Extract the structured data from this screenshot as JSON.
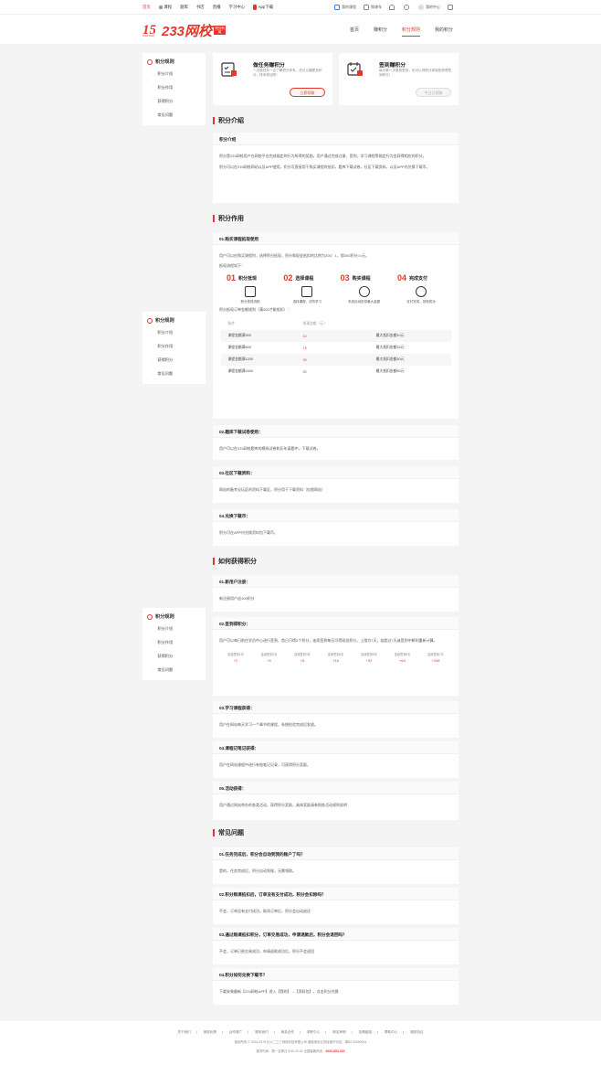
{
  "topbar": {
    "nav": [
      "首页",
      "题库",
      "书店",
      "直播",
      "学习中心"
    ],
    "nav_course": "课程",
    "app": "App下载",
    "right": [
      "我的课程",
      "购课车",
      "",
      "",
      "我的中心",
      ""
    ]
  },
  "logo": {
    "n15": "15",
    "text": "233网校",
    "badge": "积分商城",
    "years": "2004-2019"
  },
  "mainnav": [
    "首页",
    "赚积分",
    "积分规则",
    "我的积分"
  ],
  "sidebar": {
    "title": "积分规则",
    "items": [
      "积分介绍",
      "积分作用",
      "获得积分",
      "常见问题"
    ]
  },
  "cards": [
    {
      "title": "做任务赚积分",
      "desc": "一边做任务一边了解积分体系，还可以赚更多积分，快来参加吧！",
      "button": "立即领取"
    },
    {
      "title": "签到赚积分",
      "desc": "每天第一次登录签到，也可以领积分将轻松获得签到积分！",
      "button": "今日已领取"
    }
  ],
  "s1": {
    "title": "积分介绍",
    "box_title": "积分介绍",
    "p1": "积分是233网校用户在网校平台完成指定的行为所得的奖励。用户通过完成注册、签到、学习课程等指定行为会获得相应的积分。",
    "p2": "积分可以在233网校网站以及APP使用，积分可直接用于购买课程时抵扣，题库下载试卷，社区下载资料，以及APP内兑换下载币。"
  },
  "s2": {
    "title": "积分作用",
    "b1_title": "01.购买课程抵现使用",
    "b1_p1": "用户可以在购买课程时，选择积分抵现，积分和现金抵扣的比例为200：1，即200积分=1元。",
    "b1_p2": "抵现流程如下：",
    "steps": [
      {
        "num": "01",
        "name": "积分抵现",
        "label": "积分抵现流程"
      },
      {
        "num": "02",
        "name": "选择课程",
        "label": "选择课程，试听学习"
      },
      {
        "num": "03",
        "name": "购买课程",
        "label": "系统自动抵扣最大金额"
      },
      {
        "num": "04",
        "name": "完成支付",
        "label": "支付完成，抵现成功"
      }
    ],
    "rule": "积分抵现订单金额规则（满300才能抵扣）：",
    "table_head": [
      "条件",
      "抵现金额（元）",
      ""
    ],
    "table_rows": [
      [
        "课程金额满300",
        "10",
        "最大抵扣金额10元"
      ],
      [
        "课程金额满600",
        "15",
        "最大抵扣金额15元"
      ],
      [
        "课程金额满1200",
        "30",
        "最大抵扣金额30元"
      ],
      [
        "课程金额满2400",
        "50",
        "最大抵扣金额50元"
      ]
    ],
    "b2_title": "02.题库下载试卷使用：",
    "b2_p": "用户可以在233网校题库的模拟试卷和历年真题中，下载试卷。",
    "b3_title": "03.社区下载资料：",
    "b3_p": "网站的备考论坛区的资料下载区，积分用于下载资料（仅限网站）",
    "b4_title": "04.兑换下载币：",
    "b4_p": "积分可在APP内兑换资料包下载币。"
  },
  "s3": {
    "title": "如何获得积分",
    "b1_title": "01.新用户注册：",
    "b1_p": "新注册用户送100积分",
    "b2_title": "02.签到得积分：",
    "b2_p": "用户可以每日前往学员中心进行签到，首日可得2个积分，连续签到每日可得双倍积分，上限为7天，若超过7天或签到中断则重新计算。",
    "days": [
      {
        "label": "连续签到1天",
        "value": "+2"
      },
      {
        "label": "连续签到2天",
        "value": "+4"
      },
      {
        "label": "连续签到3天",
        "value": "+8"
      },
      {
        "label": "连续签到4天",
        "value": "+16"
      },
      {
        "label": "连续签到5天",
        "value": "+32"
      },
      {
        "label": "连续签到6天",
        "value": "+64"
      },
      {
        "label": "连续签到7天",
        "value": "+108"
      }
    ],
    "b3_title": "03.学习课程获得：",
    "b3_p": "用户在网站每天学习一个章节的课程，系统检验完成后发放。",
    "b4_title": "04.课程记笔记获得：",
    "b4_p": "用户在网站课程中进行有效笔记记录，可获得积分奖励。",
    "b5_title": "05.活动获得：",
    "b5_p": "用户通过网站举办的各类活动，获得积分奖励，具体奖励请参照各活动规则说明"
  },
  "s4": {
    "title": "常见问题",
    "q1": "01.任务完成后，积分会自动到我的账户了吗？",
    "a1": "是的，任务完成后，积分自动到账，无需领取。",
    "q2": "02.积分购课抵扣后，订单没有支付成功，积分会扣除吗？",
    "a2": "不会，订单没有支付成功，取消订单后，积分会自动退还",
    "q3": "03.通过购课抵扣积分，订单交易成功，申请退款后，积分会退回吗？",
    "a3": "不会，订单已经交易成功，申请退款成功后，积分不会退回",
    "q4": "04.积分如何兑换下载币？",
    "a4": "下载安装最新【233网校APP】进入【我的】→【资料包】，点击积分兑换"
  },
  "footer": {
    "links": [
      "关于我们",
      "|",
      "网校优势",
      "|",
      "合作推广",
      "|",
      "联系我们",
      "|",
      "商务合作",
      "|",
      "求职中心",
      "|",
      "网站声明",
      "|",
      "友情链接",
      "|",
      "帮助中心",
      "|",
      "服务协议"
    ],
    "copyright": "版权所有 © 2004-2019 长沙二三三网络科技有限公司   增值电信业务经营许可证：湘B2-20090004",
    "service_prefix": "服务时间：周一至周日 8:00-22:30  全国客服热线：",
    "phone": "4000-800-233"
  }
}
